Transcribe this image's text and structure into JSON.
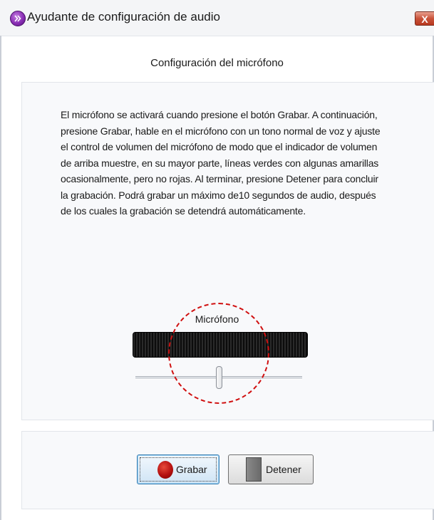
{
  "window": {
    "title": "Ayudante de configuración de audio",
    "app_icon": "purple-chevron-icon",
    "close_label": "X"
  },
  "section": {
    "title": "Configuración del micrófono"
  },
  "instructions": {
    "text": "El micrófono se activará cuando presione el botón Grabar. A continuación, presione Grabar, hable en el micrófono con un tono normal de voz y ajuste el control de volumen del micrófono de modo que el indicador de volumen de arriba muestre, en su mayor parte, líneas verdes con algunas amarillas ocasionalmente, pero no rojas. Al terminar, presione Detener para concluir la grabación. Podrá grabar un máximo de10 segundos de audio, después de los cuales la grabación se detendrá automáticamente."
  },
  "microphone": {
    "label": "Micrófono",
    "volume_level": 0.5
  },
  "buttons": {
    "record_label": "Grabar",
    "record_icon": "record-icon",
    "stop_label": "Detener",
    "stop_icon": "stop-icon"
  },
  "colors": {
    "highlight": "#d01010",
    "record": "#b41010",
    "app_icon": "#8a2fb5"
  }
}
